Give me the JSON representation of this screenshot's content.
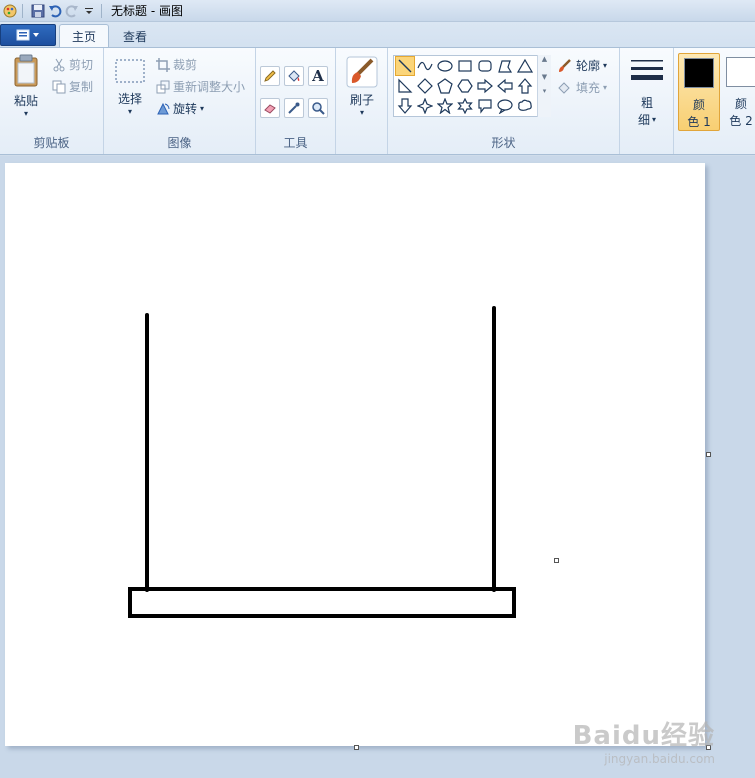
{
  "window": {
    "title": "无标题 - 画图"
  },
  "tabs": [
    {
      "label": "主页"
    },
    {
      "label": "查看"
    }
  ],
  "ribbon": {
    "clipboard": {
      "group_label": "剪贴板",
      "paste": "粘贴",
      "cut": "剪切",
      "copy": "复制"
    },
    "image": {
      "group_label": "图像",
      "select": "选择",
      "crop": "裁剪",
      "resize": "重新调整大小",
      "rotate": "旋转"
    },
    "tools": {
      "group_label": "工具",
      "text_glyph": "A"
    },
    "brushes": {
      "label": "刷子"
    },
    "shapes": {
      "group_label": "形状",
      "outline": "轮廓",
      "fill": "填充"
    },
    "size": {
      "label_line1": "粗",
      "label_line2": "细"
    },
    "colors": {
      "color1_line1": "颜",
      "color1_line2": "色 1",
      "color2_line1": "颜",
      "color2_line2": "色 2",
      "color1_value": "#000000",
      "color2_value": "#ffffff"
    }
  },
  "watermark": {
    "brand": "Baidu经验",
    "url": "jingyan.baidu.com"
  }
}
